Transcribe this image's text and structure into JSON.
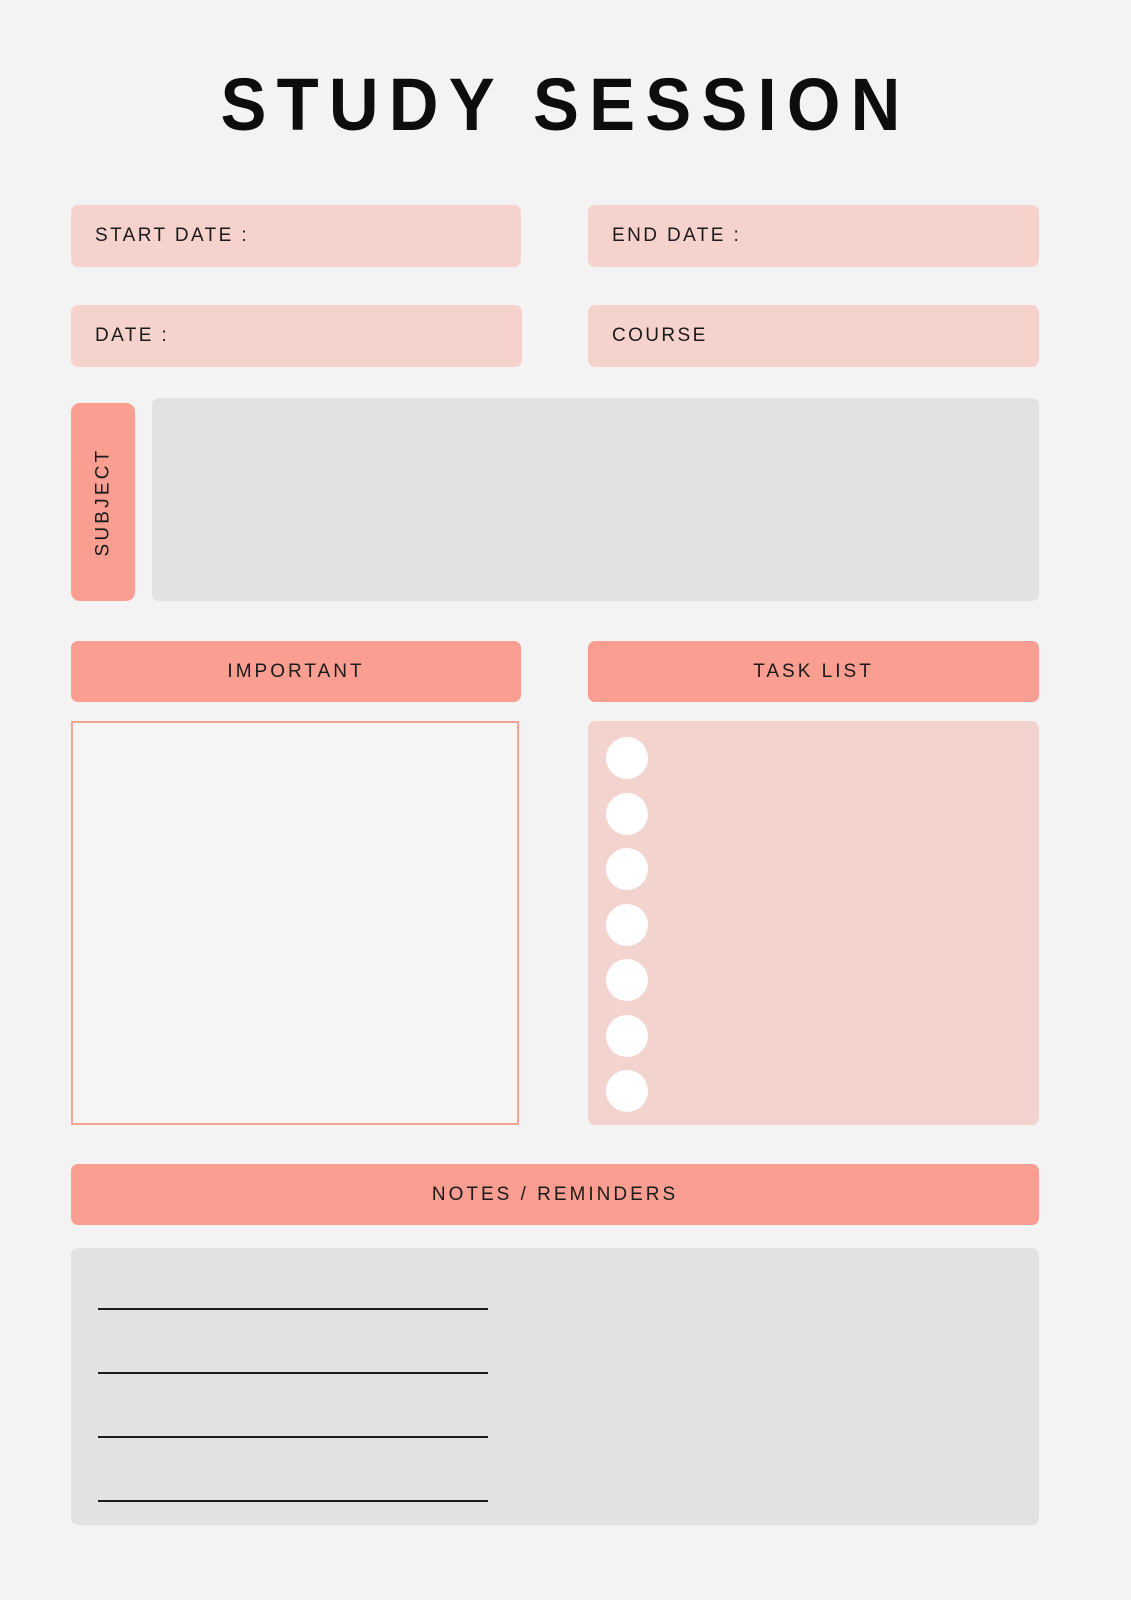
{
  "page": {
    "title": "STUDY SESSION",
    "background_color": "#f3f3f3"
  },
  "colors": {
    "coral": "#fa9e91",
    "pink_field": "#f5d2cc",
    "pink_panel": "#f3d3cd",
    "gray_box": "#e2e2e2",
    "page_bg": "#f3f3f3",
    "text": "#1a1a1a",
    "rule": "#1c1c1c",
    "important_border": "#f5a393",
    "bullet": "#ffffff"
  },
  "fields": [
    {
      "name": "start-date",
      "label": "START DATE :"
    },
    {
      "name": "end-date",
      "label": "END DATE :"
    },
    {
      "name": "date",
      "label": "DATE :"
    },
    {
      "name": "course",
      "label": "COURSE"
    }
  ],
  "subject": {
    "label": "SUBJECT"
  },
  "sections": {
    "important": {
      "label": "IMPORTANT"
    },
    "task_list": {
      "label": "TASK LIST"
    },
    "notes": {
      "label": "NOTES / REMINDERS"
    }
  },
  "task_list": {
    "item_count": 7,
    "items": [
      {
        "checked": false,
        "text": ""
      },
      {
        "checked": false,
        "text": ""
      },
      {
        "checked": false,
        "text": ""
      },
      {
        "checked": false,
        "text": ""
      },
      {
        "checked": false,
        "text": ""
      },
      {
        "checked": false,
        "text": ""
      },
      {
        "checked": false,
        "text": ""
      }
    ]
  },
  "notes": {
    "line_count": 4,
    "lines": [
      "",
      "",
      "",
      ""
    ]
  }
}
